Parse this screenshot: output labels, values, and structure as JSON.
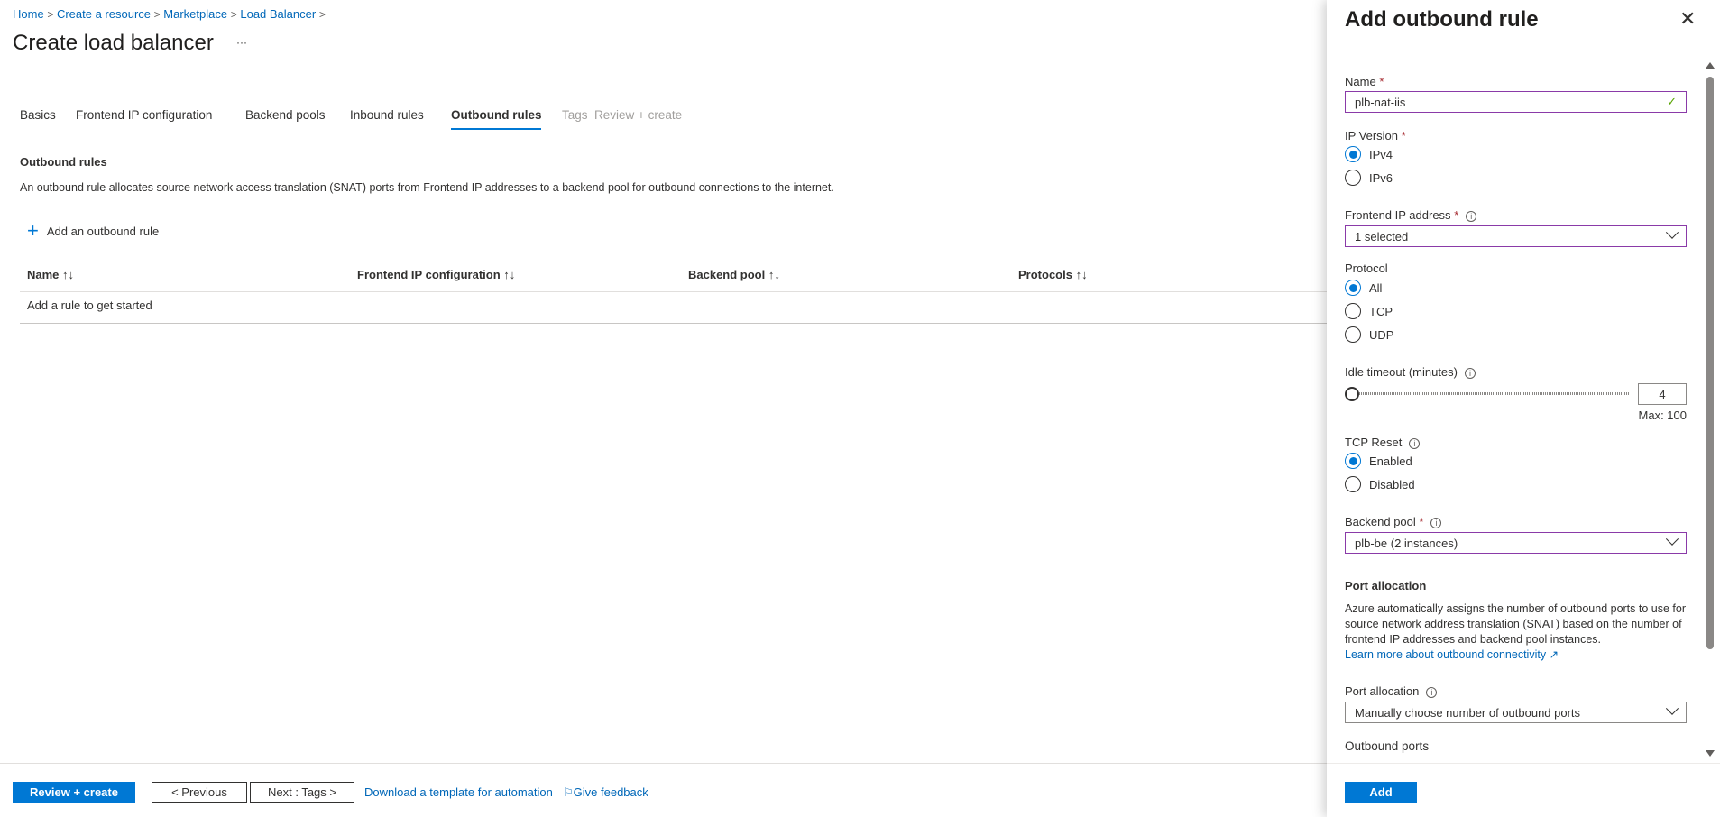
{
  "breadcrumb": [
    "Home",
    "Create a resource",
    "Marketplace",
    "Load Balancer"
  ],
  "page": {
    "title": "Create load balancer",
    "more": "···"
  },
  "tabs": [
    "Basics",
    "Frontend IP configuration",
    "Backend pools",
    "Inbound rules",
    "Outbound rules",
    "Tags",
    "Review + create"
  ],
  "section": {
    "title": "Outbound rules",
    "description": "An outbound rule allocates source network access translation (SNAT) ports from Frontend IP addresses to a backend pool for outbound connections to the internet.",
    "add_label": "Add an outbound rule"
  },
  "table": {
    "columns": [
      "Name",
      "Frontend IP configuration",
      "Backend pool",
      "Protocols"
    ],
    "sort_glyph": "↑↓",
    "empty": "Add a rule to get started"
  },
  "footer": {
    "review": "Review + create",
    "previous": "< Previous",
    "next": "Next : Tags >",
    "download": "Download a template for automation",
    "feedback": "Give feedback"
  },
  "panel": {
    "title": "Add outbound rule",
    "name_label": "Name",
    "name_value": "plb-nat-iis",
    "ipver_label": "IP Version",
    "ipver_options": [
      "IPv4",
      "IPv6"
    ],
    "frontend_label": "Frontend IP address",
    "frontend_value": "1 selected",
    "protocol_label": "Protocol",
    "protocol_options": [
      "All",
      "TCP",
      "UDP"
    ],
    "idle_label": "Idle timeout (minutes)",
    "idle_value": "4",
    "idle_max": "Max: 100",
    "tcpreset_label": "TCP Reset",
    "tcpreset_options": [
      "Enabled",
      "Disabled"
    ],
    "backend_label": "Backend pool",
    "backend_value": "plb-be (2 instances)",
    "portalloc_heading": "Port allocation",
    "portalloc_desc": "Azure automatically assigns the number of outbound ports to use for source network address translation (SNAT) based on the number of frontend IP addresses and backend pool instances.",
    "learn_more": "Learn more about outbound connectivity",
    "portalloc_label": "Port allocation",
    "portalloc_value": "Manually choose number of outbound ports",
    "outports_label": "Outbound ports",
    "add": "Add",
    "req": "*"
  }
}
